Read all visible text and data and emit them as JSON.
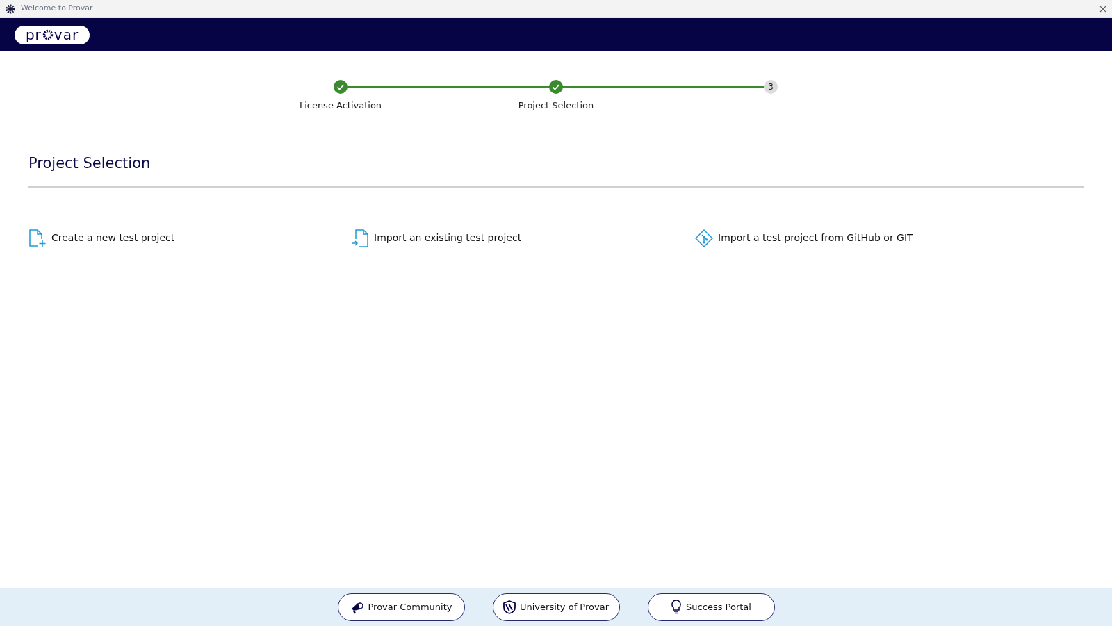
{
  "window": {
    "title": "Welcome to Provar"
  },
  "logo": {
    "text_before": "pr",
    "text_after": "var"
  },
  "steps": [
    {
      "label": "License Activation",
      "completed": true
    },
    {
      "label": "Project Selection",
      "completed": true
    },
    {
      "number": "3",
      "completed": false
    }
  ],
  "heading": "Project Selection",
  "actions": [
    {
      "kind": "new",
      "label": "Create a new test project"
    },
    {
      "kind": "import",
      "label": "Import an existing test project"
    },
    {
      "kind": "git",
      "label": "Import a test project from GitHub or GIT"
    }
  ],
  "footer_buttons": [
    {
      "kind": "community",
      "label": "Provar Community"
    },
    {
      "kind": "university",
      "label": "University of Provar"
    },
    {
      "kind": "success",
      "label": "Success Portal"
    }
  ]
}
